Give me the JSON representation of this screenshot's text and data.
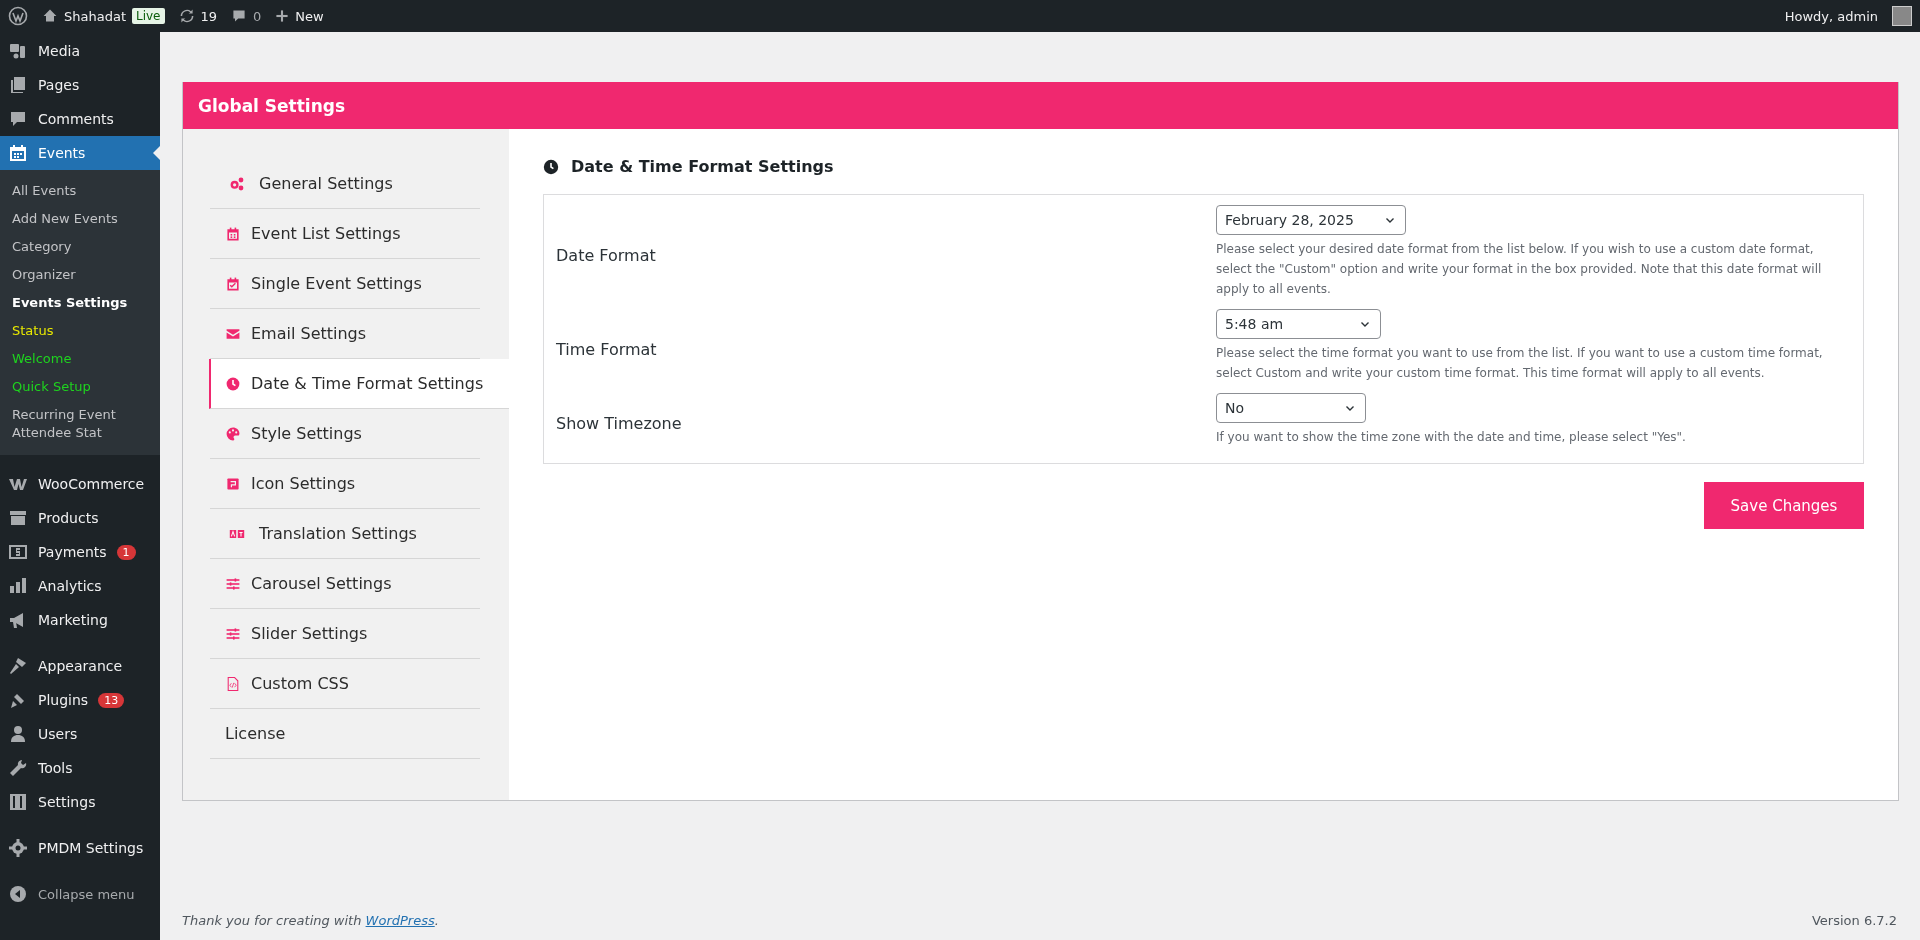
{
  "admin_bar": {
    "site_name": "Shahadat",
    "live_badge": "Live",
    "updates_count": "19",
    "comments_count": "0",
    "new_label": "New",
    "greeting": "Howdy, admin"
  },
  "sidebar": {
    "groups": [
      [
        {
          "label": "Media",
          "selected": false
        },
        {
          "label": "Pages",
          "selected": false
        },
        {
          "label": "Comments",
          "selected": false
        },
        {
          "label": "Events",
          "selected": true,
          "children": [
            {
              "label": "All Events",
              "selected": false,
              "color": "#c3c4c7"
            },
            {
              "label": "Add New Events",
              "selected": false,
              "color": "#c3c4c7"
            },
            {
              "label": "Category",
              "selected": false,
              "color": "#c3c4c7"
            },
            {
              "label": "Organizer",
              "selected": false,
              "color": "#c3c4c7"
            },
            {
              "label": "Events Settings",
              "selected": true,
              "color": "#ffffff"
            },
            {
              "label": "Status",
              "selected": false,
              "color": "#e8e800"
            },
            {
              "label": "Welcome",
              "selected": false,
              "color": "#1ed41e"
            },
            {
              "label": "Quick Setup",
              "selected": false,
              "color": "#1ed41e"
            },
            {
              "label": "Recurring Event Attendee Stat",
              "selected": false,
              "color": "#c3c4c7"
            }
          ]
        }
      ],
      [
        {
          "label": "WooCommerce",
          "selected": false
        },
        {
          "label": "Products",
          "selected": false
        },
        {
          "label": "Payments",
          "selected": false,
          "badge": "1"
        },
        {
          "label": "Analytics",
          "selected": false
        },
        {
          "label": "Marketing",
          "selected": false
        }
      ],
      [
        {
          "label": "Appearance",
          "selected": false
        },
        {
          "label": "Plugins",
          "selected": false,
          "badge": "13"
        },
        {
          "label": "Users",
          "selected": false
        },
        {
          "label": "Tools",
          "selected": false
        },
        {
          "label": "Settings",
          "selected": false
        }
      ],
      [
        {
          "label": "PMDM Settings",
          "selected": false
        }
      ]
    ],
    "collapse_label": "Collapse menu"
  },
  "settings": {
    "title": "Global Settings",
    "nav": [
      {
        "label": "General Settings",
        "selected": false
      },
      {
        "label": "Event List Settings",
        "selected": false
      },
      {
        "label": "Single Event Settings",
        "selected": false
      },
      {
        "label": "Email Settings",
        "selected": false
      },
      {
        "label": "Date & Time Format Settings",
        "selected": true
      },
      {
        "label": "Style Settings",
        "selected": false
      },
      {
        "label": "Icon Settings",
        "selected": false
      },
      {
        "label": "Translation Settings",
        "selected": false
      },
      {
        "label": "Carousel Settings",
        "selected": false
      },
      {
        "label": "Slider Settings",
        "selected": false
      },
      {
        "label": "Custom CSS",
        "selected": false
      },
      {
        "label": "License",
        "selected": false
      }
    ],
    "section_title": "Date & Time Format Settings",
    "rows": [
      {
        "label": "Date Format",
        "value": "February 28, 2025",
        "description": "Please select your desired date format from the list below. If you wish to use a custom date format, select the \"Custom\" option and write your format in the box provided. Note that this date format will apply to all events."
      },
      {
        "label": "Time Format",
        "value": "5:48 am",
        "description": "Please select the time format you want to use from the list. If you want to use a custom time format, select Custom and write your custom time format. This time format will apply to all events."
      },
      {
        "label": "Show Timezone",
        "value": "No",
        "description": "If you want to show the time zone with the date and time, please select \"Yes\"."
      }
    ],
    "save_button": "Save Changes"
  },
  "footer": {
    "credit_text": "Thank you for creating with ",
    "credit_link": "WordPress",
    "credit_end": ".",
    "version": "Version 6.7.2"
  }
}
